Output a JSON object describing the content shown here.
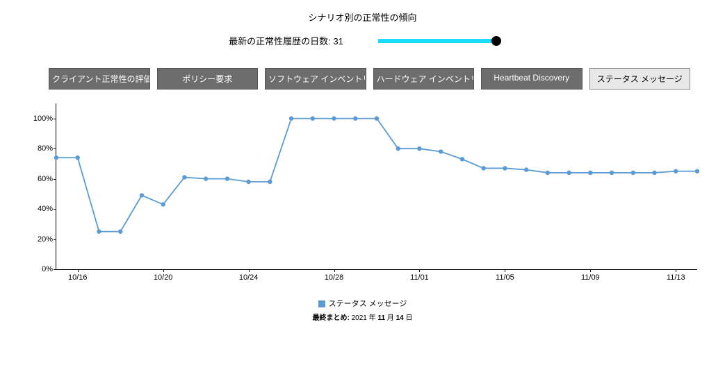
{
  "title": "シナリオ別の正常性の傾向",
  "slider": {
    "label_prefix": "最新の正常性履歴の日数: ",
    "value": 31
  },
  "tabs": [
    {
      "id": "client-health-eval",
      "label": "クライアント正常性の評価",
      "active": false
    },
    {
      "id": "policy-request",
      "label": "ポリシー要求",
      "active": false
    },
    {
      "id": "software-inventory",
      "label": "ソフトウェア インベントリ",
      "active": false
    },
    {
      "id": "hardware-inventory",
      "label": "ハードウェア インベントリ",
      "active": false
    },
    {
      "id": "heartbeat-discovery",
      "label": "Heartbeat Discovery",
      "active": false
    },
    {
      "id": "status-messages",
      "label": "ステータス メッセージ",
      "active": true
    }
  ],
  "legend": {
    "series_name": "ステータス メッセージ",
    "color": "#5b9bd5"
  },
  "footer": {
    "prefix": "最終まとめ: ",
    "year": "2021",
    "sep1": " 年 ",
    "month": "11",
    "sep2": " 月 ",
    "day": "14",
    "suffix": " 日"
  },
  "chart_data": {
    "type": "line",
    "title": "シナリオ別の正常性の傾向",
    "xlabel": "",
    "ylabel": "",
    "ylim": [
      0,
      110
    ],
    "yticks": [
      0,
      20,
      40,
      60,
      80,
      100
    ],
    "ytick_labels": [
      "0%",
      "20%",
      "40%",
      "60%",
      "80%",
      "100%"
    ],
    "xticks": [
      "10/16",
      "10/20",
      "10/24",
      "10/28",
      "11/01",
      "11/05",
      "11/09",
      "11/13"
    ],
    "x": [
      "10/15",
      "10/16",
      "10/17",
      "10/18",
      "10/19",
      "10/20",
      "10/21",
      "10/22",
      "10/23",
      "10/24",
      "10/25",
      "10/26",
      "10/27",
      "10/28",
      "10/29",
      "10/30",
      "10/31",
      "11/01",
      "11/02",
      "11/03",
      "11/04",
      "11/05",
      "11/06",
      "11/07",
      "11/08",
      "11/09",
      "11/10",
      "11/11",
      "11/12",
      "11/13",
      "11/14"
    ],
    "series": [
      {
        "name": "ステータス メッセージ",
        "color": "#5b9bd5",
        "values": [
          74,
          74,
          25,
          25,
          49,
          43,
          61,
          60,
          60,
          58,
          58,
          100,
          100,
          100,
          100,
          100,
          80,
          80,
          78,
          73,
          67,
          67,
          66,
          64,
          64,
          64,
          64,
          64,
          64,
          65,
          65
        ]
      }
    ]
  }
}
